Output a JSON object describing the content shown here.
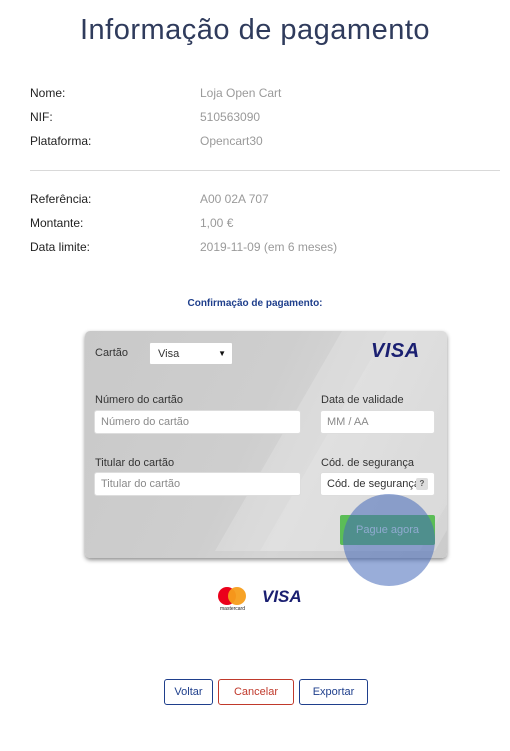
{
  "page": {
    "title": "Informação de pagamento"
  },
  "merchant": {
    "name_label": "Nome:",
    "name_value": "Loja Open Cart",
    "nif_label": "NIF:",
    "nif_value": "510563090",
    "platform_label": "Plataforma:",
    "platform_value": "Opencart30"
  },
  "payment": {
    "reference_label": "Referência:",
    "reference_value": "A00 02A 707",
    "amount_label": "Montante:",
    "amount_value": "1,00 €",
    "deadline_label": "Data limite:",
    "deadline_value": "2019-11-09 (em 6 meses)"
  },
  "confirmation_title": "Confirmação de pagamento:",
  "card_form": {
    "card_type_label": "Cartão",
    "card_type_selected": "Visa",
    "card_brand": "VISA",
    "card_number_label": "Número do cartão",
    "card_number_placeholder": "Número do cartão",
    "expiry_label": "Data de validade",
    "expiry_placeholder": "MM / AA",
    "holder_label": "Titular do cartão",
    "holder_placeholder": "Titular do cartão",
    "cvv_label": "Cód. de segurança",
    "cvv_placeholder": "Cód. de segurança",
    "cvv_help": "?",
    "pay_button": "Pague agora"
  },
  "brand_logos": {
    "mastercard_text": "mastercard",
    "visa_text": "VISA"
  },
  "actions": {
    "back": "Voltar",
    "cancel": "Cancelar",
    "export": "Exportar"
  },
  "colors": {
    "title": "#2f3b5c",
    "confirm": "#1f3f8c",
    "pay_button": "#5bbd57",
    "cancel_text": "#c0392b",
    "button_text": "#1f3f8c",
    "visa": "#1a1f71"
  }
}
